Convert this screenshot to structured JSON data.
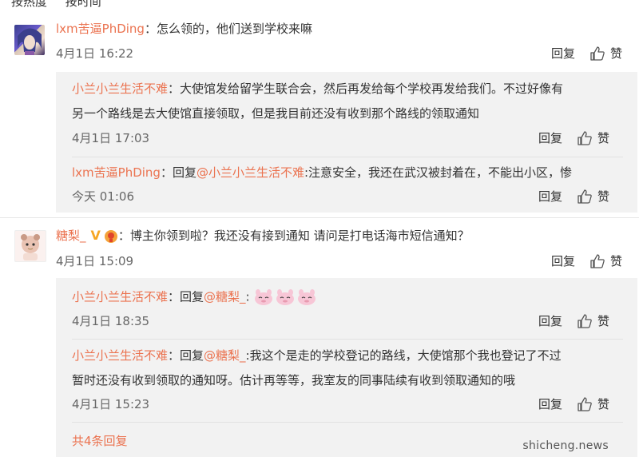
{
  "sort_tabs": [
    "按热度",
    "按时间"
  ],
  "comments": [
    {
      "user": "lxm苦逼PhDing",
      "text": "：怎么领的，他们送到学校来嘛",
      "time": "4月1日 16:22",
      "reply_label": "回复",
      "like_label": "赞",
      "replies": [
        {
          "user": "小兰小兰生活不难",
          "line1": "：大使馆发给留学生联合会，然后再发给每个学校再发给我们。不过好像有",
          "line2": "另一个路线是去大使馆直接领取，但是我目前还没有收到那个路线的领取通知",
          "time": "4月1日 17:03",
          "reply_label": "回复",
          "like_label": "赞"
        },
        {
          "user": "lxm苦逼PhDing",
          "prefix": "：回复",
          "mention": "@小兰小兰生活不难",
          "text": ":注意安全，我还在武汉被封着在，不能出小区，惨",
          "time": "今天 01:06",
          "reply_label": "回复",
          "like_label": "赞"
        }
      ]
    },
    {
      "user": "糖梨_",
      "text": "：博主你领到啦？我还没有接到通知 请问是打电话海市短信通知？",
      "time": "4月1日 15:09",
      "reply_label": "回复",
      "like_label": "赞",
      "replies": [
        {
          "user": "小兰小兰生活不难",
          "prefix": "：回复",
          "mention": "@糖梨_",
          "text": ":",
          "time": "4月1日 18:35",
          "reply_label": "回复",
          "like_label": "赞"
        },
        {
          "user": "小兰小兰生活不难",
          "prefix": "：回复",
          "mention": "@糖梨_",
          "line1": ":我这个是走的学校登记的路线，大使馆那个我也登记了不过",
          "line2": "暂时还没有收到领取的通知呀。估计再等等，我室友的同事陆续有收到领取通知的哦",
          "time": "4月1日 15:23",
          "reply_label": "回复",
          "like_label": "赞"
        }
      ],
      "more_replies": "共4条回复"
    }
  ],
  "watermark": "shicheng.news",
  "colors": {
    "name": "#eb7350",
    "reply_bg": "#f2f2f2",
    "vip": "#f6a623"
  }
}
